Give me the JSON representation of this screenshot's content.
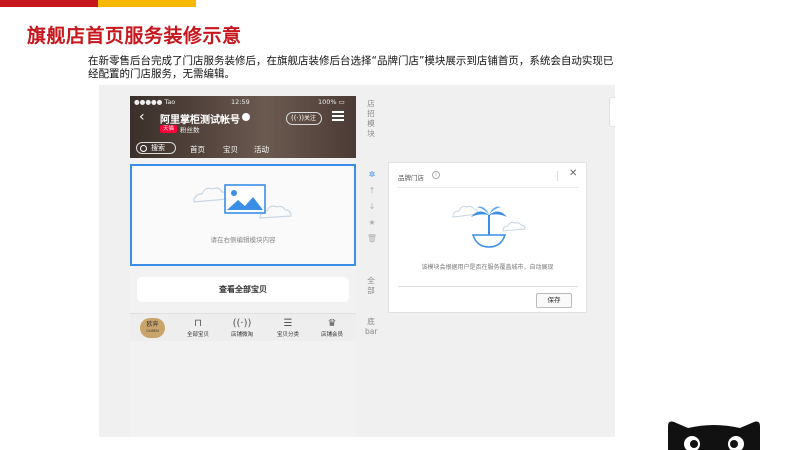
{
  "slide": {
    "title": "旗舰店首页服务装修示意",
    "description": "在新零售后台完成了门店服务装修后，在旗舰店装修后台选择“品牌门店”模块展示到店铺首页，系统会自动实现已经配置的门店服务，无需编辑。",
    "accent_red": "#c8161d",
    "accent_yellow": "#f6b800"
  },
  "phone": {
    "status": {
      "carrier": "●●●●● Tao  ",
      "time": "12:59",
      "battery": "100% ▭"
    },
    "store_name": "阿里掌柜测试帐号",
    "badge": "天猫",
    "fans": "粉丝数",
    "follow": "关注",
    "search": "搜索",
    "nav_tabs": [
      "首页",
      "宝贝",
      "活动"
    ],
    "module_hint": "请在右侧编辑模块内容",
    "view_all": "查看全部宝贝",
    "logo": {
      "main": "欧奔",
      "sub": "OUBEN"
    },
    "bottom_nav": [
      {
        "icon": "shopping-bag-icon",
        "glyph": "⊓",
        "label": "全部宝贝"
      },
      {
        "icon": "broadcast-icon",
        "glyph": "((·))",
        "label": "店铺微淘"
      },
      {
        "icon": "list-icon",
        "glyph": "☰",
        "label": "宝贝分类"
      },
      {
        "icon": "crown-icon",
        "glyph": "♛",
        "label": "店铺会员"
      }
    ]
  },
  "side": {
    "top_label": "店招模块",
    "mid_label": "全部",
    "bottom_label": "底bar"
  },
  "tools": [
    {
      "name": "gear-icon",
      "glyph": "✲",
      "active": true
    },
    {
      "name": "move-up-icon",
      "glyph": "↑",
      "active": false
    },
    {
      "name": "move-down-icon",
      "glyph": "↓",
      "active": false
    },
    {
      "name": "star-icon",
      "glyph": "★",
      "active": false
    },
    {
      "name": "trash-icon",
      "glyph": "🗑",
      "active": false
    }
  ],
  "panel": {
    "title": "品牌门店",
    "info": "i",
    "text": "该模块会根据用户是否在服务覆盖城市，自动展现",
    "save": "保存"
  }
}
